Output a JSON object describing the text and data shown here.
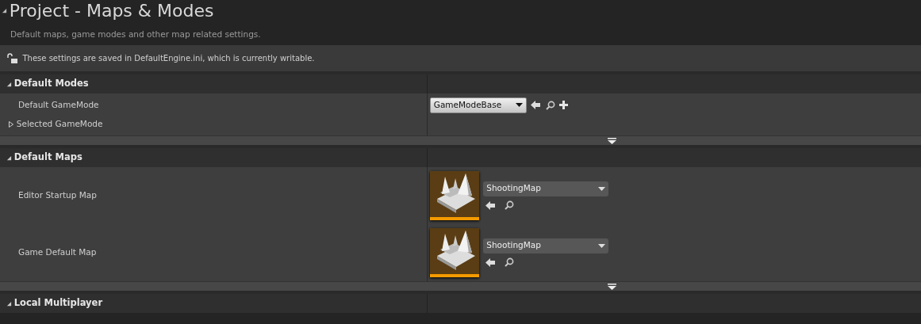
{
  "title": "Project - Maps & Modes",
  "expanded": true,
  "description": "Default maps, game modes and other map related settings.",
  "notice": {
    "text": "These settings are saved in DefaultEngine.ini, which is currently writable.",
    "locked": false
  },
  "sections": [
    {
      "title": "Default Modes",
      "expanded": true,
      "rows": [
        {
          "kind": "class",
          "label": "Default GameMode",
          "value": "GameModeBase"
        },
        {
          "kind": "group",
          "label": "Selected GameMode",
          "expanded": false
        }
      ]
    },
    {
      "title": "Default Maps",
      "expanded": true,
      "rows": [
        {
          "kind": "map",
          "label": "Editor Startup Map",
          "value": "ShootingMap"
        },
        {
          "kind": "map",
          "label": "Game Default Map",
          "value": "ShootingMap"
        }
      ]
    },
    {
      "title": "Local Multiplayer",
      "expanded": true
    }
  ]
}
